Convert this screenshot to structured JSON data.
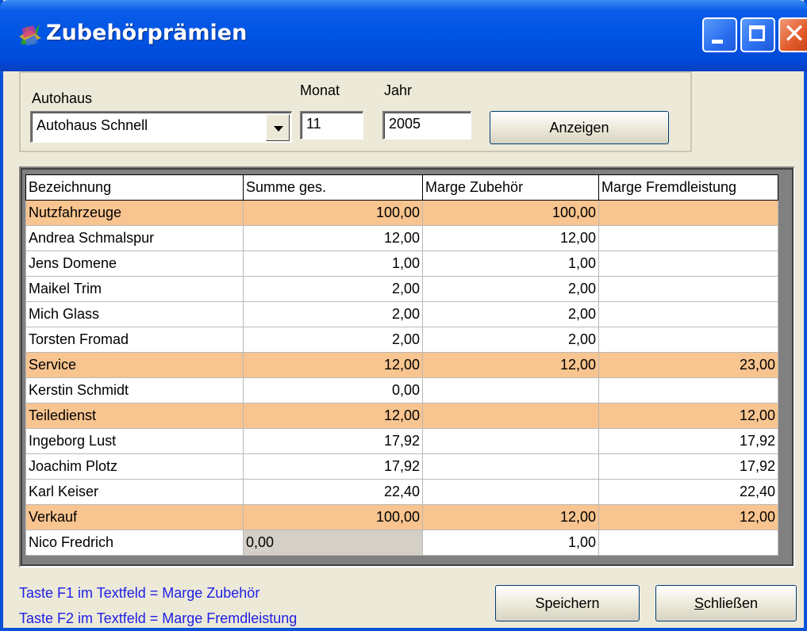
{
  "window": {
    "title": "Zubehörprämien"
  },
  "filter": {
    "autohaus_label": "Autohaus",
    "autohaus_value": "Autohaus Schnell",
    "monat_label": "Monat",
    "monat_value": "11",
    "jahr_label": "Jahr",
    "jahr_value": "2005",
    "show_button": "Anzeigen"
  },
  "grid": {
    "columns": [
      "Bezeichnung",
      "Summe ges.",
      "Marge Zubehör",
      "Marge Fremdleistung"
    ],
    "rows": [
      {
        "type": "group",
        "cells": [
          "Nutzfahrzeuge",
          "100,00",
          "100,00",
          ""
        ]
      },
      {
        "type": "item",
        "cells": [
          "Andrea Schmalspur",
          "12,00",
          "12,00",
          ""
        ]
      },
      {
        "type": "item",
        "cells": [
          "Jens Domene",
          "1,00",
          "1,00",
          ""
        ]
      },
      {
        "type": "item",
        "cells": [
          "Maikel Trim",
          "2,00",
          "2,00",
          ""
        ]
      },
      {
        "type": "item",
        "cells": [
          "Mich Glass",
          "2,00",
          "2,00",
          ""
        ]
      },
      {
        "type": "item",
        "cells": [
          "Torsten Fromad",
          "2,00",
          "2,00",
          ""
        ]
      },
      {
        "type": "group",
        "cells": [
          "Service",
          "12,00",
          "12,00",
          "23,00"
        ]
      },
      {
        "type": "item",
        "cells": [
          "Kerstin Schmidt",
          "0,00",
          "",
          ""
        ]
      },
      {
        "type": "group",
        "cells": [
          "Teiledienst",
          "12,00",
          "",
          "12,00"
        ]
      },
      {
        "type": "item",
        "cells": [
          "Ingeborg Lust",
          "17,92",
          "",
          "17,92"
        ]
      },
      {
        "type": "item",
        "cells": [
          "Joachim Plotz",
          "17,92",
          "",
          "17,92"
        ]
      },
      {
        "type": "item",
        "cells": [
          "Karl Keiser",
          "22,40",
          "",
          "22,40"
        ]
      },
      {
        "type": "group",
        "cells": [
          "Verkauf",
          "100,00",
          "12,00",
          "12,00"
        ]
      },
      {
        "type": "editing",
        "cells": [
          "Nico Fredrich",
          "0,00",
          "1,00",
          ""
        ]
      }
    ]
  },
  "hints": {
    "f1": "Taste F1 im Textfeld = Marge Zubehör",
    "f2": "Taste F2 im Textfeld = Marge Fremdleistung"
  },
  "buttons": {
    "save": "Speichern",
    "close_prefix": "S",
    "close_rest": "chließen"
  },
  "colors": {
    "group_row": "#f8c48f",
    "hint_text": "#2020e6",
    "title_bar": "#0054e3"
  }
}
